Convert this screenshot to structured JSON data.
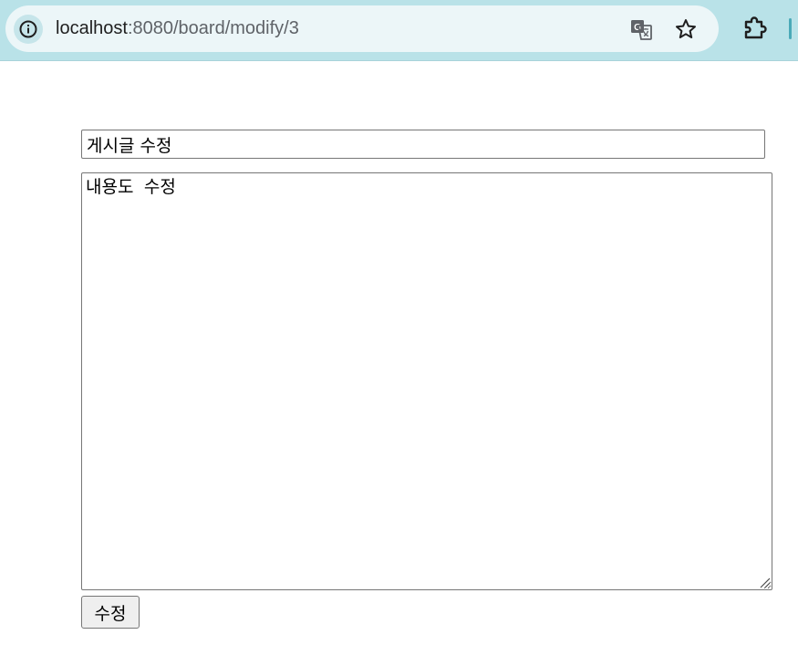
{
  "browser": {
    "url_host": "localhost",
    "url_path": ":8080/board/modify/3",
    "icons": {
      "site_info": "info-icon",
      "translate": "translate-icon",
      "bookmark": "star-icon",
      "extensions": "puzzle-icon"
    },
    "colors": {
      "toolbar_bg": "#b9e2e8",
      "omnibox_bg": "#ecf6f8"
    }
  },
  "form": {
    "title_value": "게시글 수정",
    "content_value": "내용도 수정",
    "submit_label": "수정"
  }
}
